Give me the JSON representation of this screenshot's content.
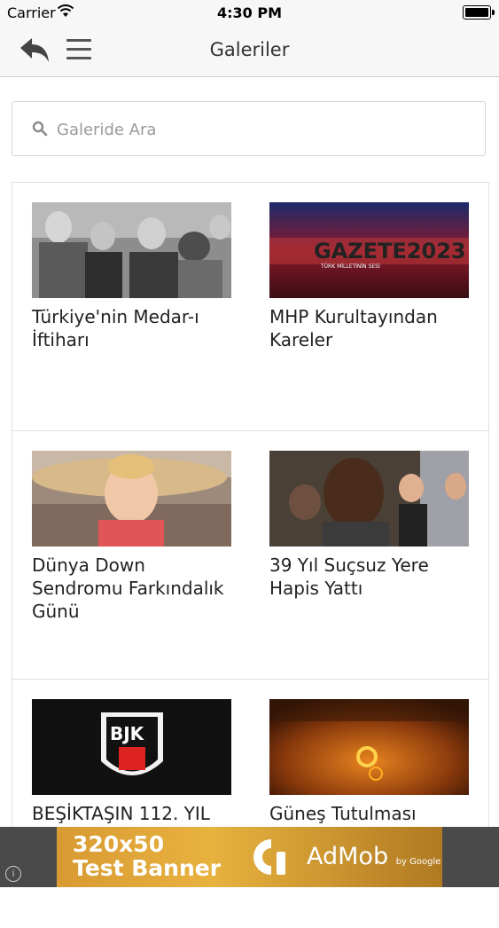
{
  "status_bar": {
    "carrier": "Carrier",
    "time": "4:30 PM"
  },
  "nav": {
    "title": "Galeriler",
    "back_icon": "reply-arrow-icon",
    "menu_icon": "hamburger-menu-icon"
  },
  "search": {
    "placeholder": "Galeride Ara",
    "value": ""
  },
  "galleries": [
    {
      "title": "Türkiye'nin Medar-ı İftiharı"
    },
    {
      "title": "MHP Kurultayından Kareler",
      "image_text": "GAZETE2023",
      "image_subtext": "TÜRK MİLLETİNİN SESİ"
    },
    {
      "title": "Dünya Down Sendromu Farkındalık Günü"
    },
    {
      "title": "39 Yıl Suçsuz Yere Hapis Yattı"
    },
    {
      "title": "BEŞİKTAŞIN 112. YIL",
      "image_text": "BJK"
    },
    {
      "title": "Güneş Tutulması"
    }
  ],
  "ad": {
    "line1": "320x50",
    "line2": "Test Banner",
    "brand": "AdMob",
    "brand_suffix": "by Google",
    "info": "i"
  }
}
